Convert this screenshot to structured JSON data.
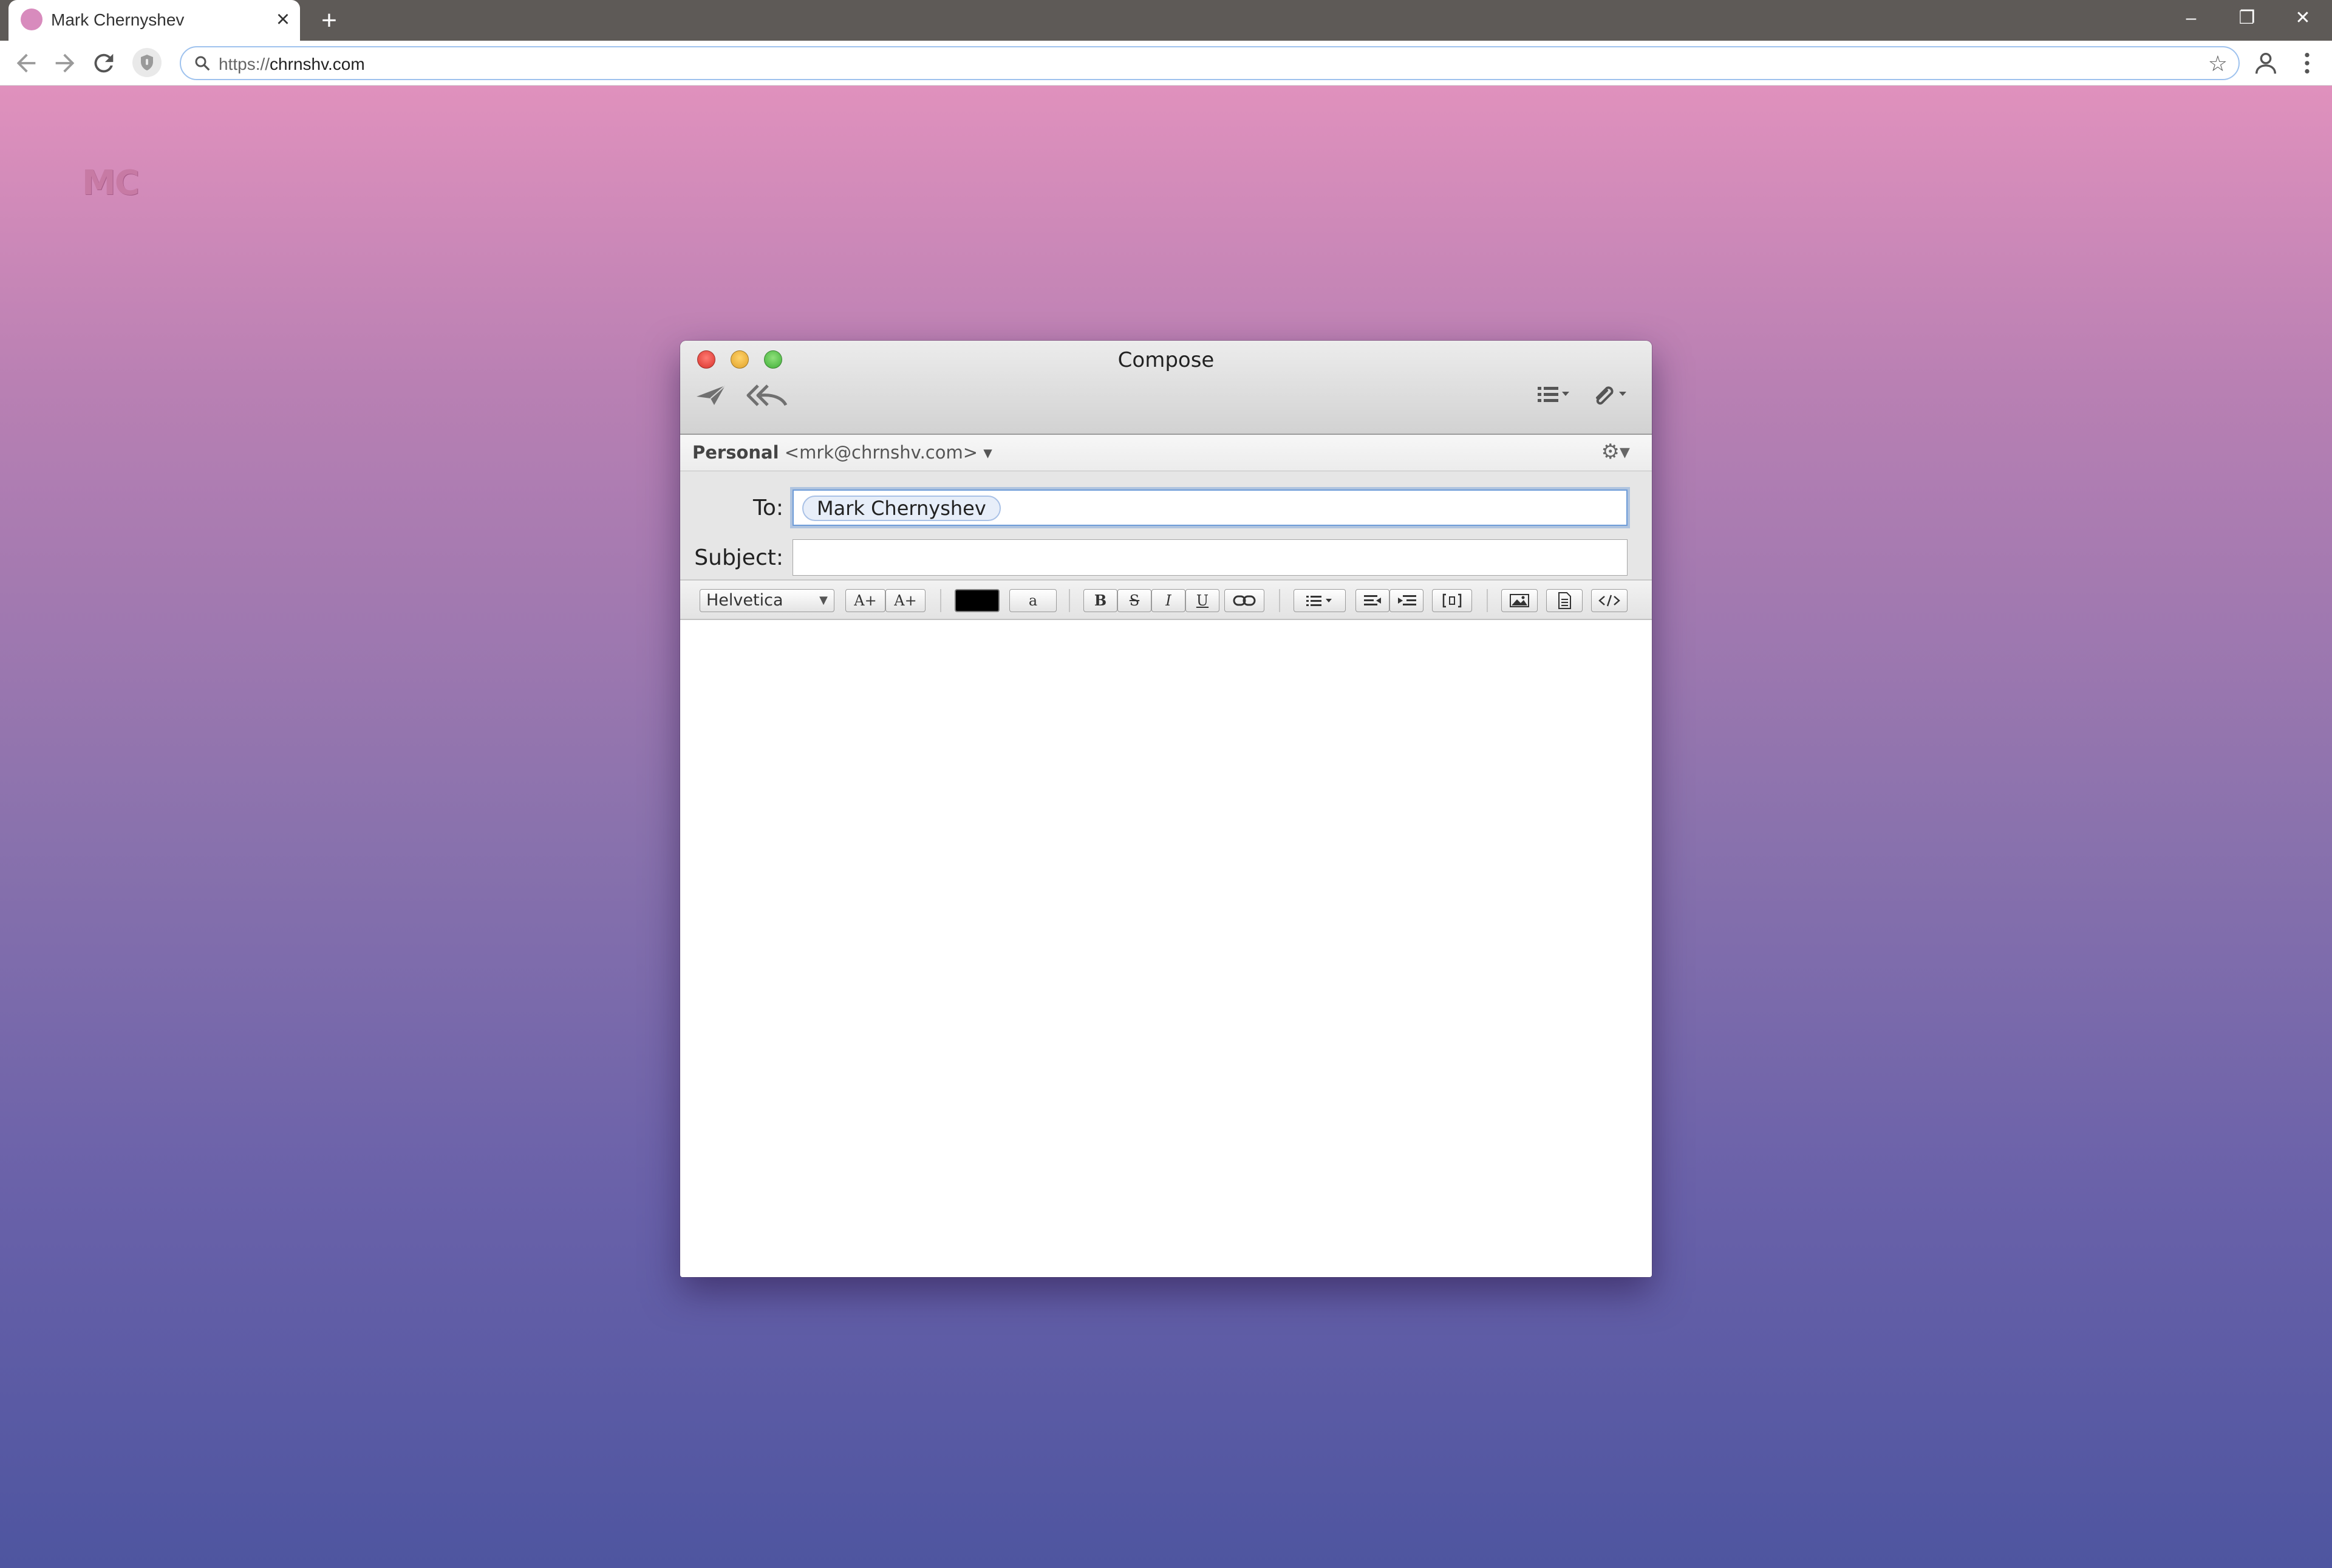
{
  "browser": {
    "tab_title": "Mark Chernyshev",
    "tab_close": "×",
    "new_tab": "+",
    "url_scheme": "https://",
    "url_host": "chrnshv.com",
    "window_controls": {
      "minimize": "–",
      "restore": "❐",
      "close": "✕"
    },
    "nav_icons": [
      "back-arrow-icon",
      "forward-arrow-icon",
      "reload-icon",
      "shield-icon",
      "search-icon",
      "star-icon",
      "profile-icon",
      "menu-kebab-icon"
    ]
  },
  "page": {
    "logo": "MC",
    "gradient_top": "#e091bd",
    "gradient_bottom": "#4e55a0"
  },
  "compose": {
    "title": "Compose",
    "from_account": "Personal",
    "from_address": "<mrk@chrnshv.com>",
    "from_caret": "▾",
    "to_label": "To:",
    "to_recipient": "Mark Chernyshev",
    "subject_label": "Subject:",
    "subject_value": "",
    "format": {
      "font_name": "Helvetica",
      "increase_size": "A+",
      "decrease_size": "A+",
      "text_color": "#000000",
      "highlight_label": "a",
      "bold": "B",
      "strikethrough": "S",
      "italic": "I",
      "underline": "U"
    },
    "body": ""
  }
}
